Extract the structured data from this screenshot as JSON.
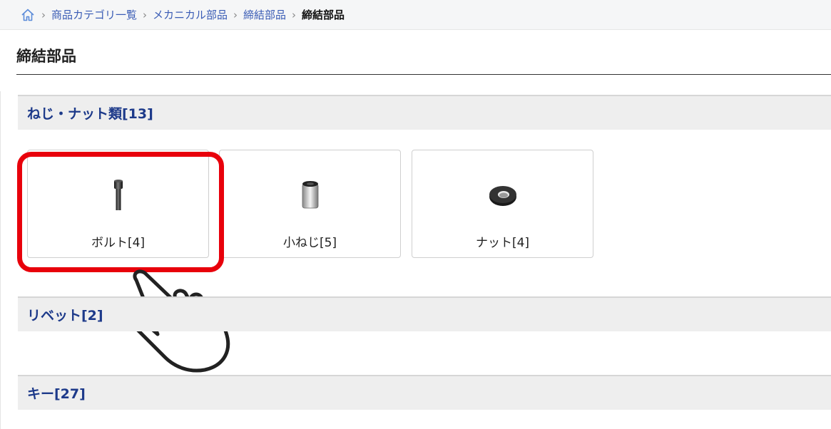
{
  "breadcrumb": {
    "items": [
      "商品カテゴリ一覧",
      "メカニカル部品",
      "締結部品"
    ],
    "current": "締結部品"
  },
  "page": {
    "title": "締結部品"
  },
  "sections": [
    {
      "label": "ねじ・ナット類[13]"
    },
    {
      "label": "リベット[2]"
    },
    {
      "label": "キー[27]"
    }
  ],
  "cards": [
    {
      "label": "ボルト[4]",
      "icon": "bolt-icon"
    },
    {
      "label": "小ねじ[5]",
      "icon": "screw-icon"
    },
    {
      "label": "ナット[4]",
      "icon": "nut-icon"
    }
  ],
  "colors": {
    "link": "#3a5cb5",
    "section_text": "#1d3a8a",
    "highlight": "#e8000b"
  }
}
